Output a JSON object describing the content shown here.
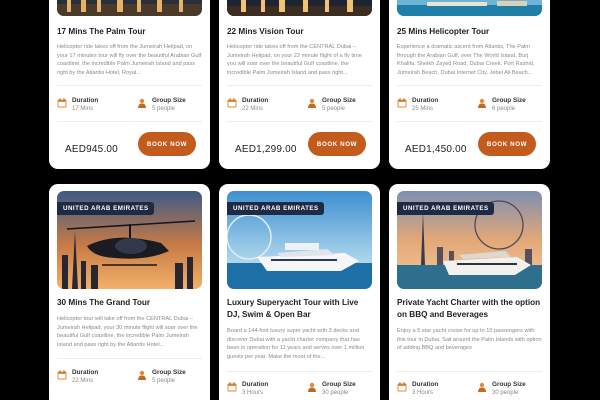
{
  "labels": {
    "duration": "Duration",
    "group_size": "Group Size",
    "book_now": "BOOK NOW"
  },
  "top_row": [
    {
      "title": "17 Mins The Palm Tour",
      "description": "Helicopter ride takes off from the Jumeirah Helipad, on your 17 minutes tour will fly over the beautiful Arabian Gulf coastline, the incredible Palm Jumeirah Island and pass right by the Atlantis Hotel, Royal...",
      "duration": "17 Mins",
      "group_size": "5 people",
      "price": "AED945.00"
    },
    {
      "title": "22 Mins Vision Tour",
      "description": "Helicopter ride takes off from the CENTRAL Dubai – Jumeirah Helipad, on your 22 minute flight of a fly time you will soar over the beautiful Gulf coastline, the incredible Palm Jumeirah Island and pass right...",
      "duration": "22 Mins",
      "group_size": "5 people",
      "price": "AED1,299.00"
    },
    {
      "title": "25 Mins Helicopter Tour",
      "description": "Experience a dramatic ascent from Atlantis, The Palm through the Arabian Gulf, over The World Island, Burj Khalifa, Sheikh Zayed Road, Dubai Creek, Port Rashid, Jumeirah Beach, Dubai Internet City, Jebel Ali Beach...",
      "duration": "25 Mins",
      "group_size": "6 people",
      "price": "AED1,450.00"
    }
  ],
  "bottom_row": [
    {
      "badge": "UNITED ARAB EMIRATES",
      "title": "30 Mins The Grand Tour",
      "description": "Helicopter tour will take off from the CENTRAL Dubai – Jumeirah Helipad, your 30 minute flight will soar over the beautiful Gulf coastline, the incredible Palm Jumeirah Island and pass right by the Atlantis Hotel...",
      "duration": "22 Mins",
      "group_size": "5 people"
    },
    {
      "badge": "UNITED ARAB EMIRATES",
      "title": "Luxury Superyacht Tour with Live DJ, Swim & Open Bar",
      "description": "Board a 144-foot luxury super yacht with 3 decks and discover Dubai with a yacht charter company that has been in operation for 11 years and serves over 1 million guests per year. Make the most of the...",
      "duration": "3 Hours",
      "group_size": "30 people"
    },
    {
      "badge": "UNITED ARAB EMIRATES",
      "title": "Private Yacht Charter with the option on BBQ and Beverages",
      "description": "Enjoy a 5 star yacht cruise for up to 10 passengers with this tour in Dubai. Sail around the Palm Islands with option of adding BBQ and beverages",
      "duration": "3 Hours",
      "group_size": "30 people"
    }
  ]
}
